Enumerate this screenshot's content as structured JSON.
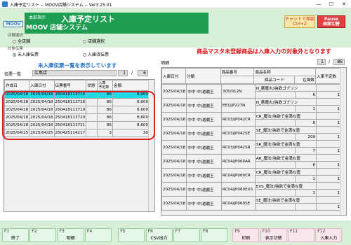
{
  "window": {
    "title": "入庫予定リスト -- MOOV店舗システム -- Ver3.25.01",
    "min": "—",
    "max": "☐",
    "close": "✕"
  },
  "header": {
    "logo": "MOOV",
    "sub": "本部指示",
    "title": "入庫予定リスト",
    "system": "MOOV 店舗システム",
    "chat": {
      "line1": "チャットで相談",
      "line2": "Ctrl+Z"
    },
    "pause": {
      "line1": "Pause",
      "line2": "画面切替"
    }
  },
  "filters": {
    "store_group_label": "店舗選択",
    "store_options": [
      "全店舗",
      "店舗選択"
    ],
    "target_group_label": "対象伝票",
    "target_options": [
      "未入庫伝票",
      "入庫済伝票"
    ]
  },
  "message": "商品マスタ未登録商品は入庫入力の対象外となります",
  "left": {
    "blue_title": "未入庫伝票一覧を表示しています",
    "list_label": "伝票一覧",
    "store": "広島店",
    "page_current": "1",
    "page_sep": "/",
    "page_total": "6",
    "columns": [
      "作成日",
      "入庫日付",
      "伝票番号",
      "状態",
      "入庫\n予定数",
      "金額"
    ],
    "rows": [
      [
        "2025/04/18",
        "2025/04/18",
        "250418113714",
        "",
        "86",
        "8,600"
      ],
      [
        "2025/04/18",
        "2025/04/18",
        "250418113716",
        "",
        "86",
        "8,600"
      ],
      [
        "2025/04/18",
        "2025/04/18",
        "250418113719",
        "",
        "86",
        "8,600"
      ],
      [
        "2025/04/18",
        "2025/04/18",
        "250418113720",
        "",
        "86",
        "8,600"
      ],
      [
        "2025/04/18",
        "2025/04/18",
        "250418113721",
        "",
        "86",
        "8,600"
      ],
      [
        "2025/04/25",
        "2025/04/25",
        "250425114217",
        "",
        "3",
        "30"
      ]
    ]
  },
  "right": {
    "detail_label": "明細",
    "page_current": "1",
    "page_sep": "/",
    "page_total": "86",
    "columns": [
      "入庫日付",
      "分類",
      "商品番号",
      "商品名称",
      "入庫予定数"
    ],
    "sub_columns": [
      "",
      "",
      "",
      "個品コード",
      "在庫数"
    ],
    "rows": [
      {
        "date": "2025/04/18",
        "cat": "中中 中)遊戯王",
        "code": "305/012N",
        "name": "N_悪魔丸)強欲ゴブリン",
        "barcode": "",
        "stock": "6",
        "plan": "1"
      },
      {
        "date": "2025/04/18",
        "cat": "中中 中)遊戯王",
        "code": "EE1/JP227N",
        "name": "N_悪魔丸)強欲ゴブリン",
        "barcode": "",
        "stock": "1",
        "plan": "1"
      },
      {
        "date": "2025/04/18",
        "cat": "中中 中)遊戯王",
        "code": "RC03/JP042CR",
        "name": "CR_魔法)強欲で金満な壺",
        "barcode": "",
        "stock": "8",
        "plan": "1"
      },
      {
        "date": "2025/04/18",
        "cat": "中中 中)遊戯王",
        "code": "RC03/JP042SE",
        "name": "SE_魔法)強欲で金満な壺",
        "barcode": "",
        "stock": "209",
        "plan": "1"
      },
      {
        "date": "2025/04/18",
        "cat": "中中 中)遊戯王",
        "code": "RC03/JP042SR",
        "name": "SR_魔法)強欲で金満な壺",
        "barcode": "",
        "stock": "7",
        "plan": "1"
      },
      {
        "date": "2025/04/18",
        "cat": "中中 中)遊戯王",
        "code": "RC04/JP060AR",
        "name": "AR_魔法)強欲で金満な壺",
        "barcode": "",
        "stock": "6",
        "plan": "1"
      },
      {
        "date": "2025/04/18",
        "cat": "中中 中)遊戯王",
        "code": "RC04/JP060CR",
        "name": "CR_魔法)強欲で金満な壺",
        "barcode": "",
        "stock": "1",
        "plan": "1"
      },
      {
        "date": "2025/04/18",
        "cat": "中中 中)遊戯王",
        "code": "RC04/JP060EXS",
        "name": "EXS_魔法)強欲で金満な壺",
        "barcode": "",
        "stock": "1",
        "plan": "1"
      },
      {
        "date": "2025/04/18",
        "cat": "中中 中)遊戯王",
        "code": "RC04/JP060SE",
        "name": "SE_魔法)強欲で金満な壺",
        "barcode": "",
        "stock": "",
        "plan": "1"
      }
    ]
  },
  "fkeys": [
    {
      "key": "F1",
      "label": "終了"
    },
    {
      "key": "F2",
      "label": ""
    },
    {
      "key": "F3",
      "label": "明細"
    },
    {
      "key": "F4",
      "label": ""
    },
    {
      "key": "F5",
      "label": ""
    },
    {
      "key": "F6",
      "label": "CSV出力"
    },
    {
      "key": "F7",
      "label": ""
    },
    {
      "key": "F8",
      "label": ""
    },
    {
      "key": "F9",
      "label": "印刷"
    },
    {
      "key": "F10",
      "label": "表示切替"
    },
    {
      "key": "F11",
      "label": ""
    },
    {
      "key": "F12",
      "label": "入庫入力"
    }
  ],
  "colors": {
    "banner": "#1d9e52",
    "header_bg": "#d8efd7",
    "selected_row": "#1ed9e8",
    "message_red": "#dd1111",
    "blue_title": "#1a6fc7"
  }
}
